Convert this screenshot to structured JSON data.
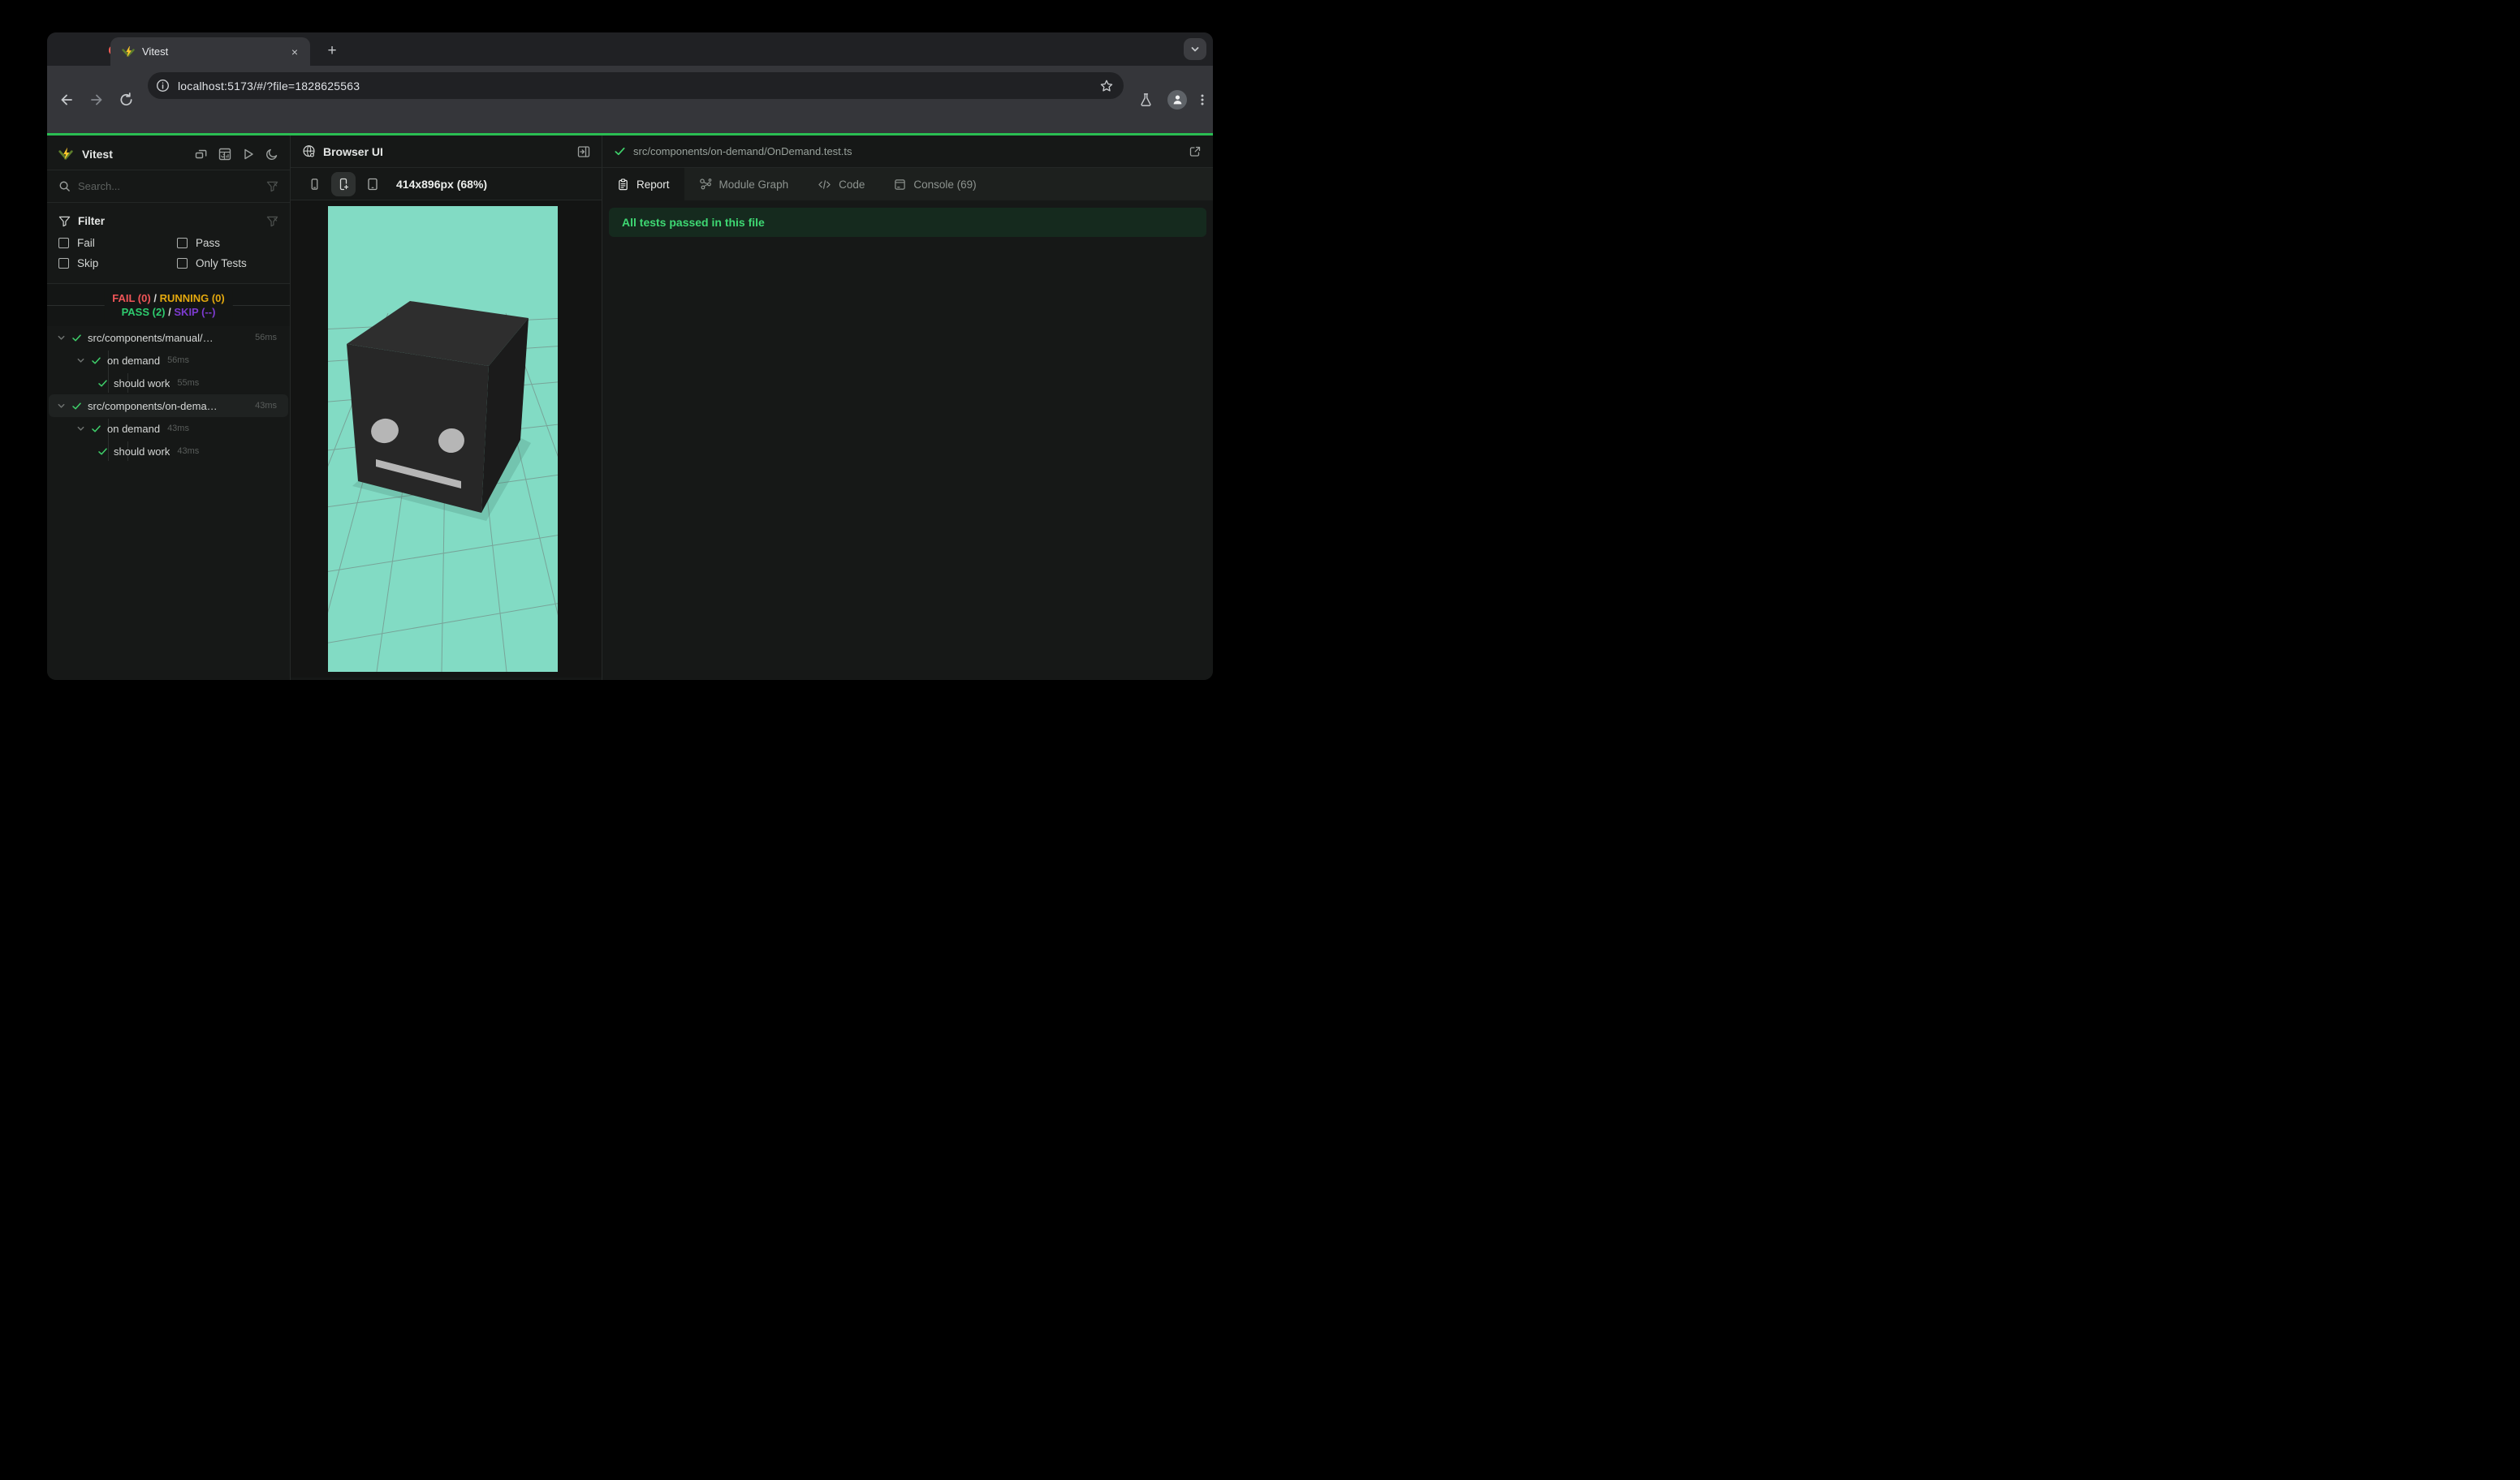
{
  "browser": {
    "tab_title": "Vitest",
    "close_glyph": "×",
    "new_tab_glyph": "+",
    "url": "localhost:5173/#/?file=1828625563"
  },
  "sidebar": {
    "app_title": "Vitest",
    "search_placeholder": "Search...",
    "filter": {
      "title": "Filter",
      "options": [
        "Fail",
        "Pass",
        "Skip",
        "Only Tests"
      ]
    },
    "summary": {
      "fail": "FAIL (0)",
      "running": "RUNNING (0)",
      "pass": "PASS (2)",
      "skip": "SKIP (--)",
      "sep": "/"
    },
    "tree": [
      {
        "level": 0,
        "name": "src/components/manual/…",
        "duration": "56ms",
        "chevron": true,
        "selected": false
      },
      {
        "level": 1,
        "name": "on demand",
        "duration": "56ms",
        "chevron": true,
        "selected": false
      },
      {
        "level": 2,
        "name": "should work",
        "duration": "55ms",
        "chevron": false,
        "selected": false
      },
      {
        "level": 0,
        "name": "src/components/on-dema…",
        "duration": "43ms",
        "chevron": true,
        "selected": true
      },
      {
        "level": 1,
        "name": "on demand",
        "duration": "43ms",
        "chevron": true,
        "selected": false
      },
      {
        "level": 2,
        "name": "should work",
        "duration": "43ms",
        "chevron": false,
        "selected": false
      }
    ]
  },
  "preview": {
    "title": "Browser UI",
    "viewport_label": "414x896px (68%)"
  },
  "results": {
    "file_path": "src/components/on-demand/OnDemand.test.ts",
    "tabs": [
      {
        "label": "Report",
        "active": true
      },
      {
        "label": "Module Graph",
        "active": false
      },
      {
        "label": "Code",
        "active": false
      },
      {
        "label": "Console (69)",
        "active": false
      }
    ],
    "banner": "All tests passed in this file"
  },
  "colors": {
    "accent_green": "#2abd52",
    "check_green": "#3ecf6a",
    "banner_bg": "#152a1e",
    "banner_text": "#3ed873",
    "fail_red": "#f05558",
    "running_yellow": "#e3a80e",
    "pass_green": "#2ecb6e",
    "skip_purple": "#7d3bd0",
    "viewport_teal": "#82dbc4"
  }
}
